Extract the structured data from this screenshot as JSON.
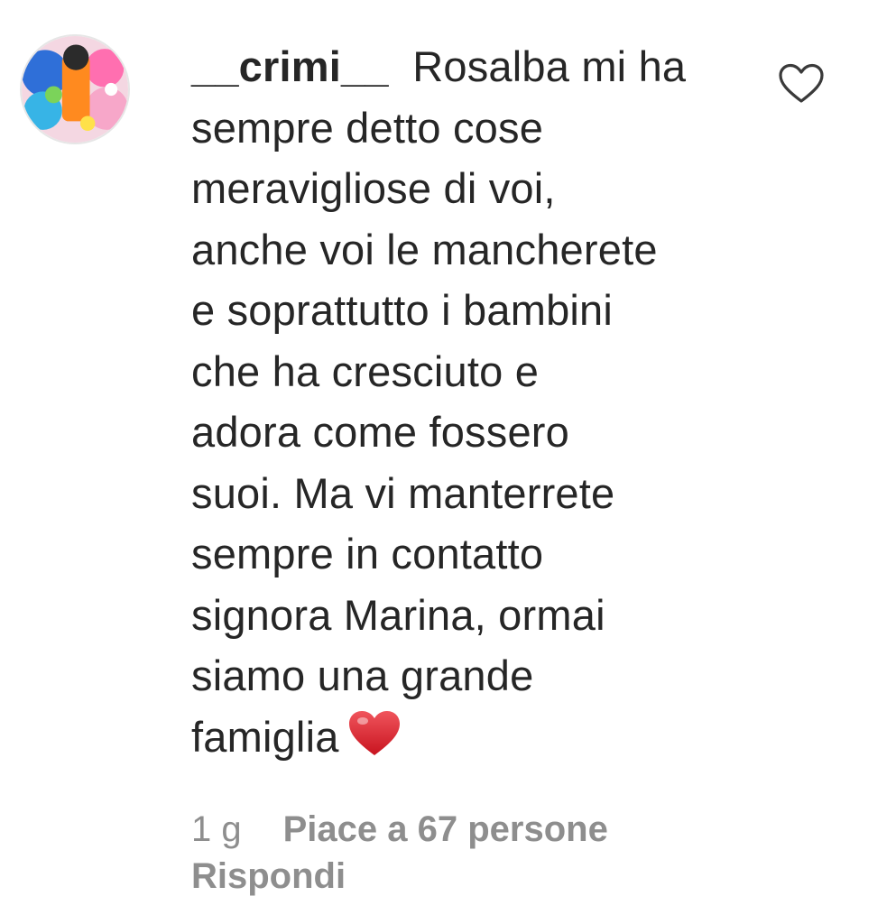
{
  "comment": {
    "username": "__crimi__",
    "text_lines": [
      "Rosalba mi ha",
      "sempre detto cose",
      "meravigliose di voi,",
      "anche voi le mancherete",
      "e soprattutto i bambini",
      "che ha cresciuto e",
      "adora come fossero",
      "suoi. Ma vi manterrete",
      "sempre in contatto",
      "signora Marina, ormai",
      "siamo una grande",
      "famiglia"
    ],
    "trailing_emoji": "red-heart-emoji",
    "time": "1 g",
    "likes_label": "Piace a 67 persone",
    "reply_label": "Rispondi"
  },
  "icons": {
    "like": "heart-outline-icon",
    "avatar": "avatar"
  },
  "colors": {
    "text": "#262626",
    "meta": "#8e8e8e",
    "heart": "#e0242e"
  }
}
